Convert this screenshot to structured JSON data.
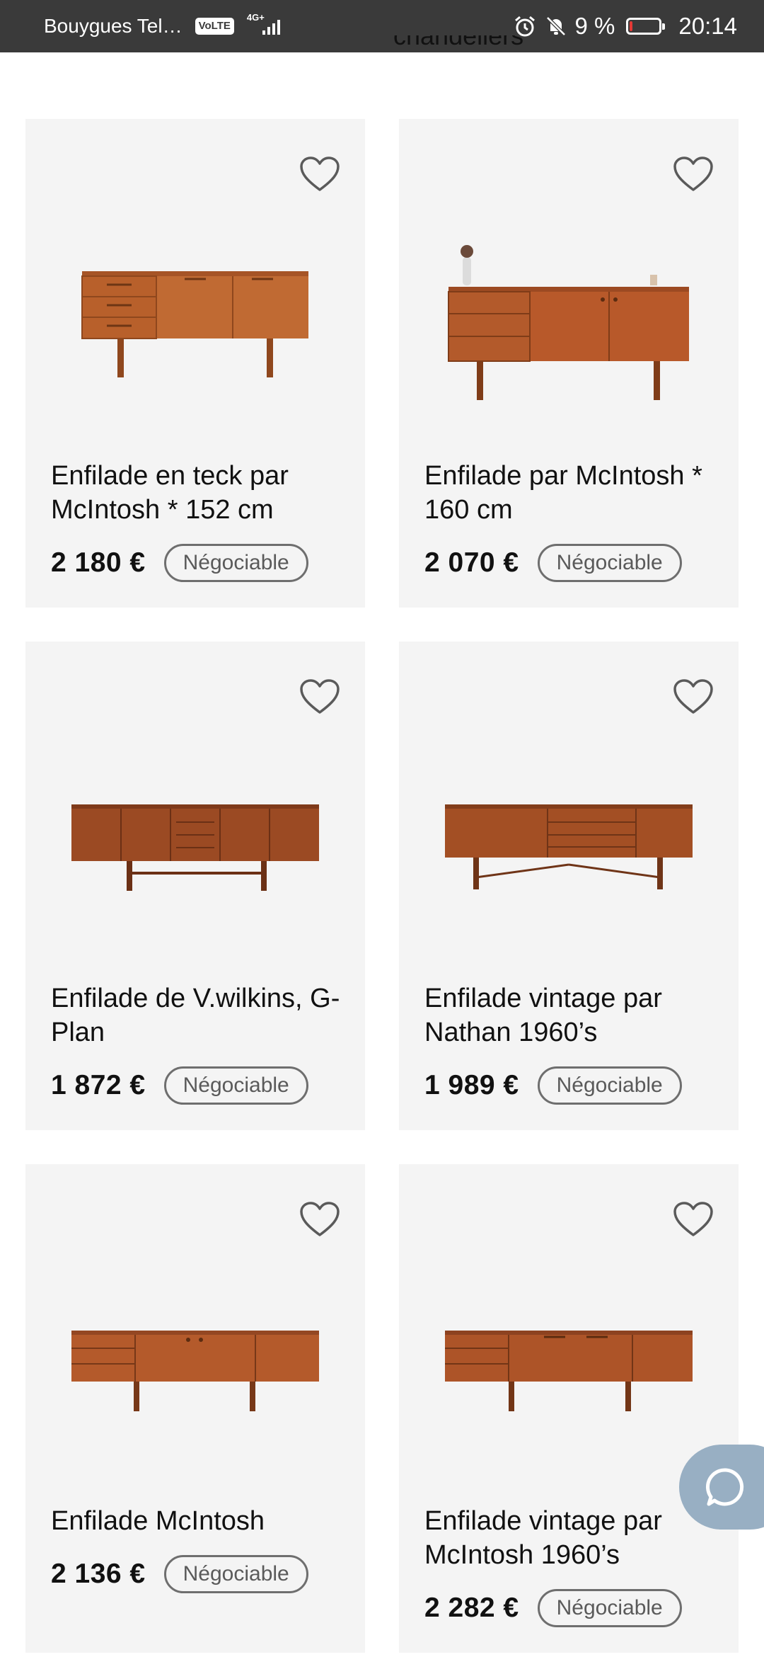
{
  "status_bar": {
    "carrier": "Bouygues Tel…",
    "volte": "VoLTE",
    "network": "4G+",
    "battery_percent": "9 %",
    "time": "20:14",
    "battery_color": "#e53935"
  },
  "section_title_cut": "chandeliers",
  "products": [
    {
      "title": "Enfilade en teck par McIntosh * 152 cm",
      "price": "2 180 €",
      "badge": "Négociable"
    },
    {
      "title": "Enfilade par McIntosh * 160 cm",
      "price": "2 070 €",
      "badge": "Négociable"
    },
    {
      "title": "Enfilade de V.wilkins, G-Plan",
      "price": "1 872 €",
      "badge": "Négociable"
    },
    {
      "title": "Enfilade vintage par Nathan 1960’s",
      "price": "1 989 €",
      "badge": "Négociable"
    },
    {
      "title": "Enfilade McIntosh",
      "price": "2 136 €",
      "badge": "Négociable"
    },
    {
      "title": "Enfilade vintage par McIntosh 1960’s",
      "price": "2 282 €",
      "badge": "Négociable"
    }
  ],
  "icons": {
    "favorite": "heart-outline-icon",
    "chat": "chat-bubble-icon",
    "alarm": "alarm-icon",
    "mute": "bell-off-icon"
  },
  "colors": {
    "card_background": "#f4f4f4",
    "chat_button": "#98afc3",
    "teak": "#b5622e"
  }
}
